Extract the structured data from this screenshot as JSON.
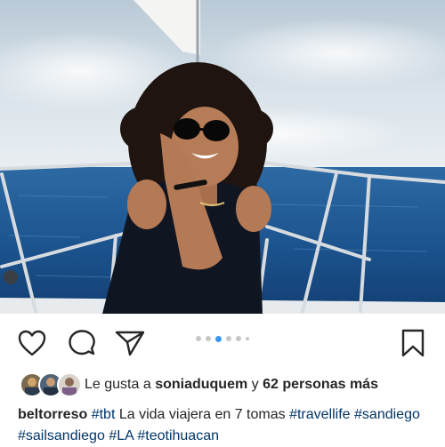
{
  "post": {
    "photo_icon": "photo-woman-on-sailboat",
    "carousel": {
      "count": 6,
      "active_index": 2
    }
  },
  "actions": {
    "like_icon": "heart-icon",
    "comment_icon": "comment-icon",
    "share_icon": "send-icon",
    "save_icon": "bookmark-icon"
  },
  "likes": {
    "prefix": "Le gusta a",
    "user": "soniaduquem",
    "connector": "y",
    "others": "62 personas más"
  },
  "caption": {
    "username": "beltorreso",
    "hashtag_1": "#tbt",
    "text": "La vida viajera en 7 tomas",
    "hashtag_2": "#travellife",
    "hashtag_3": "#sandiego",
    "hashtag_4": "#sailsandiego",
    "hashtag_5": "#LA",
    "hashtag_6": "#teotihuacan"
  },
  "colors": {
    "accent": "#3897f0",
    "hashtag": "#003569",
    "text": "#262626"
  }
}
